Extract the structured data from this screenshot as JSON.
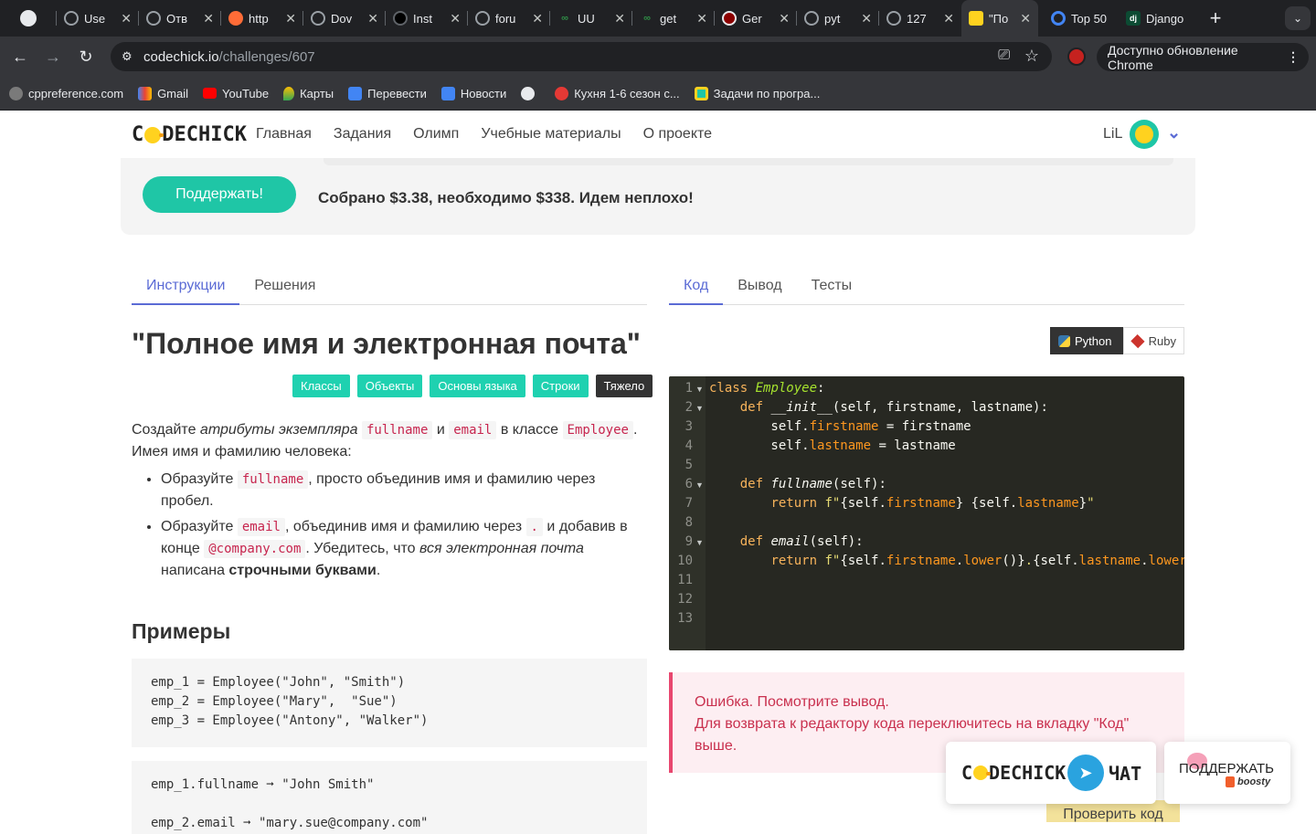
{
  "browser": {
    "tabs": [
      {
        "label": "",
        "icon": "github-icon",
        "color": "#e8eaed"
      },
      {
        "label": "Use",
        "icon": "openai-icon",
        "color": "#9aa0a6"
      },
      {
        "label": "Отв",
        "icon": "openai-icon",
        "color": "#9aa0a6"
      },
      {
        "label": "http",
        "icon": "postman-icon",
        "color": "#ff6c37"
      },
      {
        "label": "Dov",
        "icon": "openai-icon",
        "color": "#9aa0a6"
      },
      {
        "label": "Inst",
        "icon": "circle-icon",
        "color": "#5f6368"
      },
      {
        "label": "foru",
        "icon": "openai-icon",
        "color": "#9aa0a6"
      },
      {
        "label": "UU",
        "icon": "gfg-icon",
        "color": "#2f8d46"
      },
      {
        "label": "get",
        "icon": "gfg-icon",
        "color": "#2f8d46"
      },
      {
        "label": "Ger",
        "icon": "circle-icon",
        "color": "#9aa0a6"
      },
      {
        "label": "pyt",
        "icon": "openai-icon",
        "color": "#9aa0a6"
      },
      {
        "label": "127",
        "icon": "openai-icon",
        "color": "#9aa0a6"
      },
      {
        "label": "\"По",
        "icon": "chick-icon",
        "color": "#ffd21f"
      },
      {
        "label": "Top 50",
        "icon": "top50-icon",
        "color": "#4285f4"
      },
      {
        "label": "Django",
        "icon": "django-icon",
        "color": "#0c4b33"
      }
    ],
    "url_host": "codechick.io",
    "url_path": "/challenges/607",
    "update_label": "Доступно обновление Chrome",
    "bookmarks": [
      {
        "label": "cppreference.com",
        "color": "#7a7a7a"
      },
      {
        "label": "Gmail",
        "color": "#ea4335"
      },
      {
        "label": "YouTube",
        "color": "#ff0000"
      },
      {
        "label": "Карты",
        "color": "#34a853"
      },
      {
        "label": "Перевести",
        "color": "#4285f4"
      },
      {
        "label": "Новости",
        "color": "#4285f4"
      },
      {
        "label": "",
        "color": "#e8eaed"
      },
      {
        "label": "Кухня 1-6 сезон с...",
        "color": "#e53935"
      },
      {
        "label": "Задачи по програ...",
        "color": "#ffd21f"
      }
    ]
  },
  "site": {
    "logo_left": "C",
    "logo_right": "DECHICK",
    "nav": [
      "Главная",
      "Задания",
      "Олимп",
      "Учебные материалы",
      "О проекте"
    ],
    "username": "LiL",
    "support_button": "Поддержать!",
    "funds_text": "Собрано $3.38, необходимо $338. Идем неплохо!"
  },
  "left_tabs": [
    "Инструкции",
    "Решения"
  ],
  "challenge": {
    "title": "\"Полное имя и электронная почта\"",
    "tags": [
      "Классы",
      "Объекты",
      "Основы языка",
      "Строки",
      "Тяжело"
    ],
    "p1": [
      "Создайте ",
      "атрибуты экземпляра",
      " ",
      "fullname",
      " и ",
      "email",
      " в классе ",
      "Employee",
      "."
    ],
    "p2": "Имея имя и фамилию человека:",
    "li1": [
      "Образуйте ",
      "fullname",
      ", просто объединив имя и фамилию через пробел."
    ],
    "li2": [
      "Образуйте ",
      "email",
      ", объединив имя и фамилию через ",
      ".",
      " и добавив в конце ",
      "@company.com",
      ". Убедитесь, что ",
      "вся электронная почта",
      " написана ",
      "строчными буквами",
      "."
    ],
    "examples_heading": "Примеры",
    "example1": [
      "emp_1 = Employee(\"John\", \"Smith\")",
      "emp_2 = Employee(\"Mary\",  \"Sue\")",
      "emp_3 = Employee(\"Antony\", \"Walker\")"
    ],
    "example2": [
      "emp_1.fullname ➞ \"John Smith\"",
      "",
      "emp_2.email ➞ \"mary.sue@company.com\""
    ]
  },
  "right_tabs": [
    "Код",
    "Вывод",
    "Тесты"
  ],
  "languages": [
    "Python",
    "Ruby"
  ],
  "editor": {
    "line_numbers": [
      "1",
      "2",
      "3",
      "4",
      "5",
      "6",
      "7",
      "8",
      "9",
      "10",
      "11",
      "12",
      "13"
    ]
  },
  "error": {
    "line1": "Ошибка. Посмотрите вывод.",
    "line2": "Для возврата к редактору кода переключитесь на вкладку \"Код\" выше."
  },
  "widgets": {
    "chat_logo_left": "C",
    "chat_logo_right": "DECHICK",
    "chat_label": "ЧАТ",
    "support_label": "ПОДДЕРЖАТЬ",
    "boosty_label": "boosty"
  },
  "check_button": "Проверить код"
}
